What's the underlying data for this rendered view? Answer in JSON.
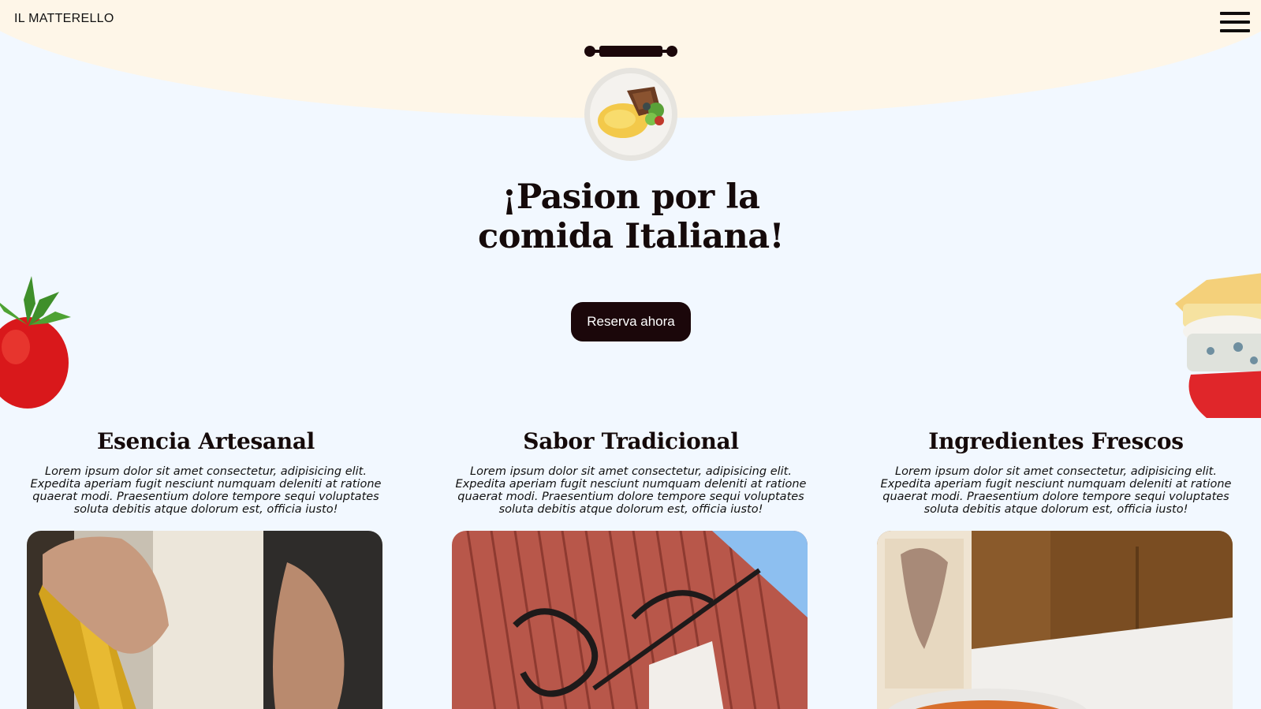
{
  "header": {
    "brand": "IL MATTERELLO",
    "menu_icon": "hamburger-menu-icon"
  },
  "hero": {
    "title_line1": "¡Pasion por la",
    "title_line2": "comida Italiana!",
    "cta_label": "Reserva ahora"
  },
  "features": [
    {
      "title": "Esencia Artesanal",
      "text": "Lorem ipsum dolor sit amet consectetur, adipisicing elit. Expedita aperiam fugit nesciunt numquam deleniti at ratione quaerat modi. Praesentium dolore tempore sequi voluptates soluta debitis atque dolorum est, officia iusto!"
    },
    {
      "title": "Sabor Tradicional",
      "text": "Lorem ipsum dolor sit amet consectetur, adipisicing elit. Expedita aperiam fugit nesciunt numquam deleniti at ratione quaerat modi. Praesentium dolore tempore sequi voluptates soluta debitis atque dolorum est, officia iusto!"
    },
    {
      "title": "Ingredientes Frescos",
      "text": "Lorem ipsum dolor sit amet consectetur, adipisicing elit. Expedita aperiam fugit nesciunt numquam deleniti at ratione quaerat modi. Praesentium dolore tempore sequi voluptates soluta debitis atque dolorum est, officia iusto!"
    }
  ],
  "colors": {
    "header_band": "#fef6e8",
    "page_background": "#f2f8ff",
    "button_background": "#1b070a",
    "text": "#150a0a"
  }
}
